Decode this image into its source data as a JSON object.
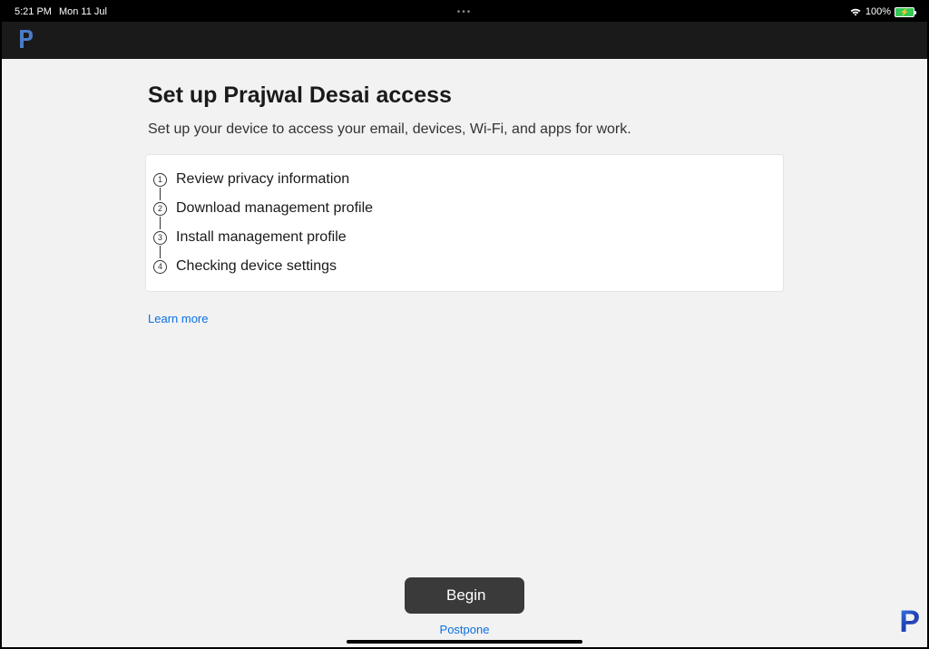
{
  "statusBar": {
    "time": "5:21 PM",
    "date": "Mon 11 Jul",
    "batteryPercent": "100%"
  },
  "header": {
    "title": "Set up Prajwal Desai access",
    "subtitle": "Set up your device to access your email, devices, Wi-Fi, and apps for work."
  },
  "steps": [
    {
      "num": "1",
      "label": "Review privacy information"
    },
    {
      "num": "2",
      "label": "Download management profile"
    },
    {
      "num": "3",
      "label": "Install management profile"
    },
    {
      "num": "4",
      "label": "Checking device settings"
    }
  ],
  "links": {
    "learnMore": "Learn more",
    "postpone": "Postpone"
  },
  "actions": {
    "begin": "Begin"
  }
}
